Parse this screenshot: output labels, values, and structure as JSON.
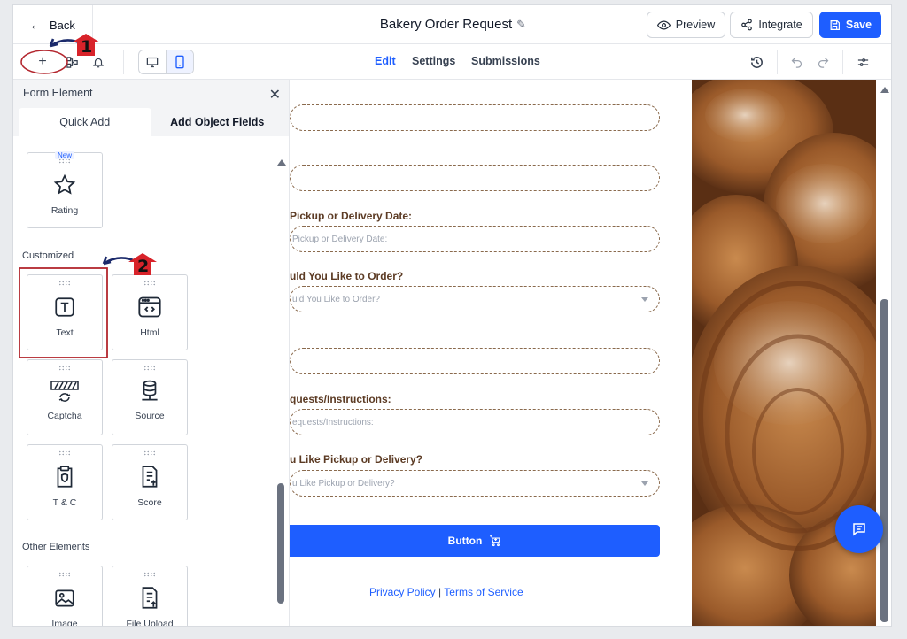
{
  "header": {
    "back_label": "Back",
    "title": "Bakery Order Request",
    "preview_label": "Preview",
    "integrate_label": "Integrate",
    "save_label": "Save"
  },
  "toolbar": {
    "tabs": [
      "Edit",
      "Settings",
      "Submissions"
    ],
    "active_tab": "Edit"
  },
  "panel": {
    "title": "Form Element",
    "tabs": [
      "Quick Add",
      "Add Object Fields"
    ],
    "new_badge": "New",
    "rating_label": "Rating",
    "sections": [
      "Customized",
      "Other Elements"
    ],
    "customized_items": [
      "Text",
      "Html",
      "Captcha",
      "Source",
      "T & C",
      "Score"
    ],
    "other_items": [
      "Image",
      "File Upload"
    ]
  },
  "form": {
    "labels": [
      "Pickup or Delivery Date:",
      "uld You Like to Order?",
      "quests/Instructions:",
      "u Like Pickup or Delivery?"
    ],
    "placeholders": [
      "Pickup or Delivery Date:",
      "uld You Like to Order?",
      "equests/Instructions:",
      "u Like Pickup or Delivery?"
    ],
    "button_label": "Button",
    "privacy_label": "Privacy Policy",
    "separator": "|",
    "terms_label": "Terms of Service"
  },
  "annotations": [
    "1",
    "2"
  ],
  "colors": {
    "accent": "#1e5eff",
    "label_brown": "#5c3b24",
    "annotation_red": "#b3262e"
  }
}
